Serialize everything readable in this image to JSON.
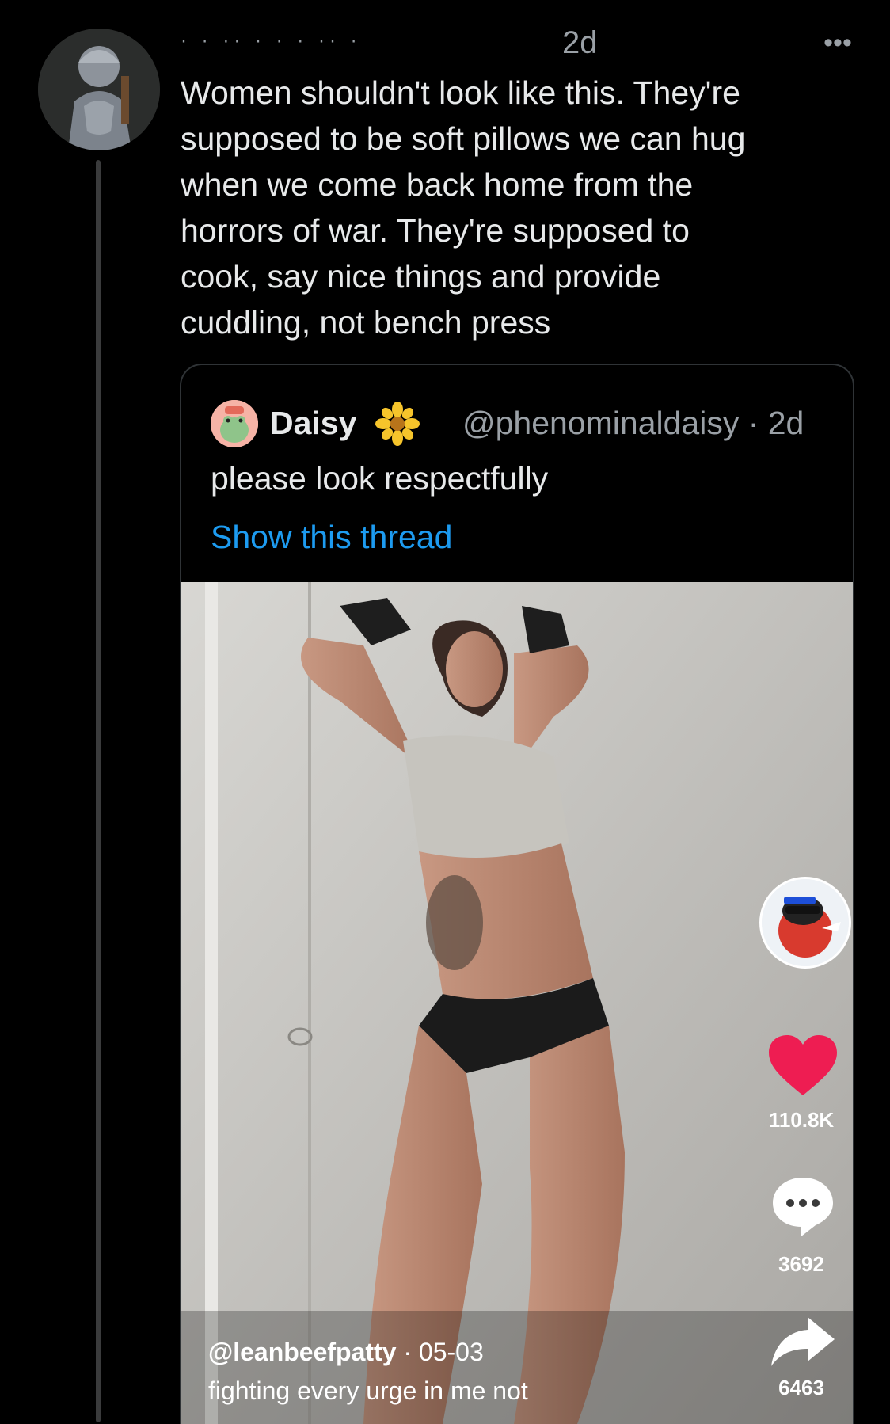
{
  "tweet": {
    "author_redacted": "· · ·· · · · ·· ·",
    "time": "2d",
    "more_icon": "more-horizontal-icon",
    "text": "Women shouldn't look like this. They're\nsupposed to be soft pillows we can hug\nwhen we come back home from the\nhorrors of war. They're supposed to\ncook, say nice things and provide\ncuddling, not bench press"
  },
  "quote": {
    "name": "Daisy",
    "handle_time": "@phenominaldaisy · 2d",
    "text": "please look respectfully",
    "link": "Show this thread"
  },
  "video": {
    "likes": "110.8K",
    "comments": "3692",
    "shares": "6463",
    "username": "@leanbeefpatty",
    "date": "· 05-03",
    "description": "fighting every urge in me not"
  },
  "colors": {
    "background": "#000000",
    "link": "#1d9bf0",
    "heart": "#ee1d52",
    "muted": "#9aa0a6"
  }
}
